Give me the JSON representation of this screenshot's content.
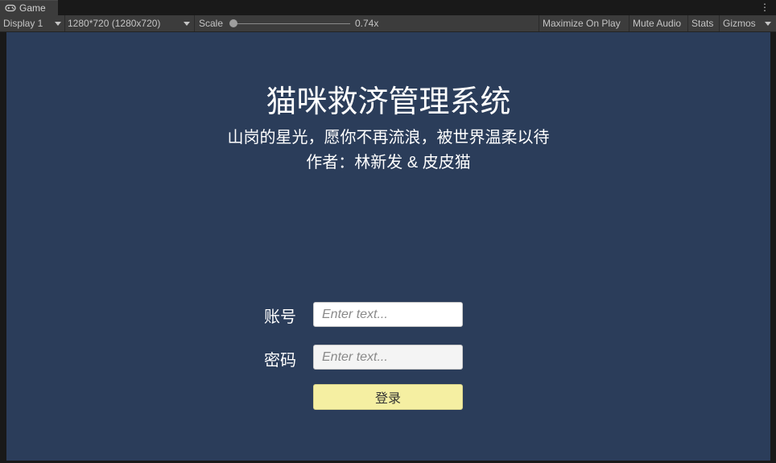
{
  "tab": {
    "title": "Game",
    "icon": "gamepad-icon",
    "menu_icon": "⋮"
  },
  "toolbar": {
    "display": "Display 1",
    "resolution": "1280*720 (1280x720)",
    "scale_label": "Scale",
    "scale_value": "0.74x",
    "scale_fraction": 0.0,
    "maximize_on_play": "Maximize On Play",
    "mute_audio": "Mute Audio",
    "stats": "Stats",
    "gizmos": "Gizmos"
  },
  "game": {
    "background_color": "#2b3d5a",
    "title": "猫咪救济管理系统",
    "subtitle": "山岗的星光，愿你不再流浪，被世界温柔以待",
    "author": "作者：林新发 & 皮皮猫",
    "username_label": "账号",
    "username_placeholder": "Enter text...",
    "password_label": "密码",
    "password_placeholder": "Enter text...",
    "login_label": "登录",
    "login_color": "#f5efa2"
  }
}
